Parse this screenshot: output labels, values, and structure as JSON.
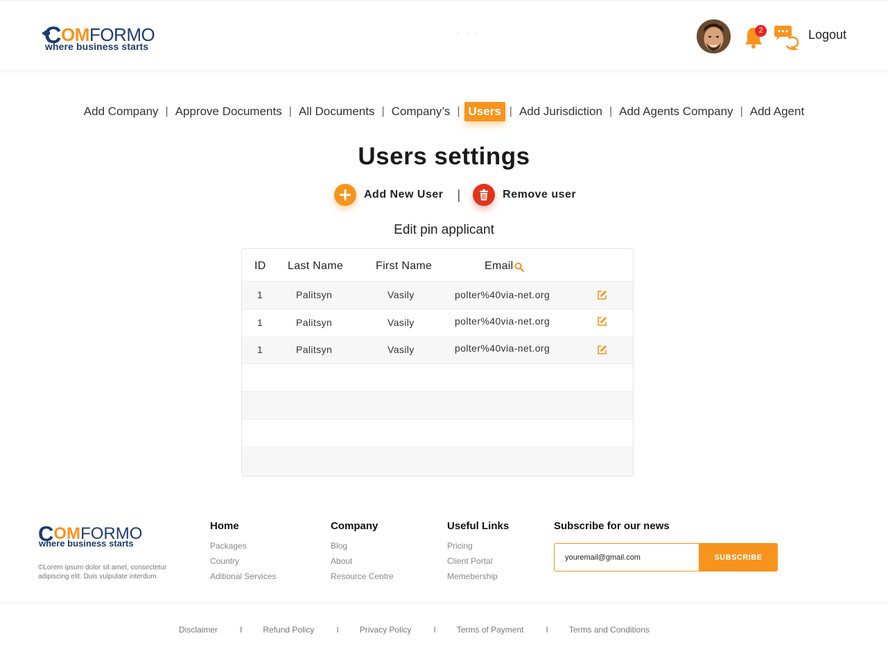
{
  "header": {
    "logo": {
      "c": "C",
      "om": "OM",
      "formo": "FORMO",
      "tagline": "where business starts"
    },
    "dots": "· · ·",
    "notification_count": "2",
    "logout_label": "Logout"
  },
  "nav": {
    "items": [
      {
        "label": "Add Company"
      },
      {
        "label": "Approve Documents"
      },
      {
        "label": "All Documents"
      },
      {
        "label": "Company’s"
      },
      {
        "label": "Users",
        "active": true
      },
      {
        "label": "Add Jurisdiction"
      },
      {
        "label": "Add Agents Company"
      },
      {
        "label": "Add Agent"
      }
    ]
  },
  "page": {
    "title": "Users settings",
    "add_user_label": "Add New User",
    "separator": "|",
    "remove_user_label": "Remove user",
    "subtitle": "Edit pin applicant"
  },
  "table": {
    "columns": [
      "ID",
      "Last Name",
      "First Name",
      "Email"
    ],
    "rows": [
      {
        "id": "1",
        "last_name": "Palitsyn",
        "first_name": "Vasily",
        "email": "polter%40via-net.org"
      },
      {
        "id": "1",
        "last_name": "Palitsyn",
        "first_name": "Vasily",
        "email": "polter%40via-net.org"
      },
      {
        "id": "1",
        "last_name": "Palitsyn",
        "first_name": "Vasily",
        "email": "polter%40via-net.org"
      }
    ]
  },
  "footer": {
    "copyright": "©Lorem ipsum dolor sit amet, consectetur adipiscing elit. Duis vulputate interdum.",
    "columns": [
      {
        "heading": "Home",
        "links": [
          "Packages",
          "Country",
          "Aditional Services"
        ]
      },
      {
        "heading": "Company",
        "links": [
          "Blog",
          "About",
          "Resource Centre"
        ]
      },
      {
        "heading": "Useful Links",
        "links": [
          "Pricing",
          "Client Portal",
          "Memebership"
        ]
      }
    ],
    "subscribe": {
      "heading": "Subscribe for our news",
      "email_value": "youremail@gmail.com",
      "button_label": "SUBSCRIBE"
    },
    "legal": [
      "Disclaimer",
      "Refund Policy",
      "Privacy Policy",
      "Terms of Payment",
      "Terms and Conditions"
    ],
    "legal_separator": "I"
  },
  "colors": {
    "accent": "#f7941d",
    "brand": "#1d3b6e",
    "danger": "#e0351c",
    "badge": "#e52420"
  }
}
